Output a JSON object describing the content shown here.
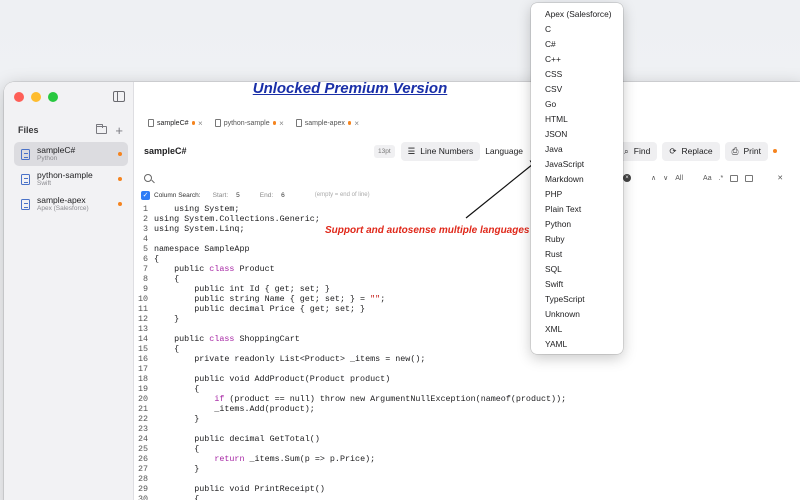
{
  "promo": {
    "text": "Unlocked Premium Version"
  },
  "annotation": {
    "text": "Support and autosense multiple languages"
  },
  "sidebar": {
    "title": "Files",
    "files": [
      {
        "name": "sampleC#",
        "lang": "Python",
        "selected": true,
        "dirty": true
      },
      {
        "name": "python-sample",
        "lang": "Swift",
        "selected": false,
        "dirty": true
      },
      {
        "name": "sample-apex",
        "lang": "Apex (Salesforce)",
        "selected": false,
        "dirty": true
      }
    ]
  },
  "tabs": [
    {
      "label": "sampleC#",
      "close": "×"
    },
    {
      "label": "python-sample",
      "close": "×"
    },
    {
      "label": "sample-apex",
      "close": "×"
    }
  ],
  "toolbar": {
    "title": "sampleC#",
    "font_size": "13pt",
    "line_numbers": "Line Numbers",
    "language": "Language",
    "find": "Find",
    "replace": "Replace",
    "print": "Print"
  },
  "search": {
    "value": "",
    "all": "All",
    "case": "Aa",
    "regex": ".*"
  },
  "column_search": {
    "label": "Column Search:",
    "start_label": "Start:",
    "start": "5",
    "end_label": "End:",
    "end": "6",
    "hint": "(empty = end of line)"
  },
  "language_menu": {
    "items": [
      "Apex (Salesforce)",
      "C",
      "C#",
      "C++",
      "CSS",
      "CSV",
      "Go",
      "HTML",
      "JSON",
      "Java",
      "JavaScript",
      "Markdown",
      "PHP",
      "Plain Text",
      "Python",
      "Ruby",
      "Rust",
      "SQL",
      "Swift",
      "TypeScript",
      "Unknown",
      "XML",
      "YAML"
    ]
  },
  "code_lines": [
    [
      [
        "    using System;",
        ""
      ]
    ],
    [
      [
        "using System.Collections.Generic;",
        ""
      ]
    ],
    [
      [
        "using System.Linq;",
        ""
      ]
    ],
    [
      [
        "",
        ""
      ]
    ],
    [
      [
        "namespace SampleApp",
        ""
      ]
    ],
    [
      [
        "{",
        ""
      ]
    ],
    [
      [
        "    public ",
        ""
      ],
      [
        "class",
        "kw"
      ],
      [
        " Product",
        ""
      ]
    ],
    [
      [
        "    {",
        ""
      ]
    ],
    [
      [
        "        public int Id { get; set; }",
        ""
      ]
    ],
    [
      [
        "        public string Name { get; set; } = ",
        ""
      ],
      [
        "\"\"",
        "str"
      ],
      [
        ";",
        ""
      ]
    ],
    [
      [
        "        public decimal Price { get; set; }",
        ""
      ]
    ],
    [
      [
        "    }",
        ""
      ]
    ],
    [
      [
        "",
        ""
      ]
    ],
    [
      [
        "    public ",
        ""
      ],
      [
        "class",
        "kw"
      ],
      [
        " ShoppingCart",
        ""
      ]
    ],
    [
      [
        "    {",
        ""
      ]
    ],
    [
      [
        "        private readonly List<Product> _items = new();",
        ""
      ]
    ],
    [
      [
        "",
        ""
      ]
    ],
    [
      [
        "        public void AddProduct(Product product)",
        ""
      ]
    ],
    [
      [
        "        {",
        ""
      ]
    ],
    [
      [
        "            ",
        ""
      ],
      [
        "if",
        "kw"
      ],
      [
        " (product == null) throw new ArgumentNullException(nameof(product));",
        ""
      ]
    ],
    [
      [
        "            _items.Add(product);",
        ""
      ]
    ],
    [
      [
        "        }",
        ""
      ]
    ],
    [
      [
        "",
        ""
      ]
    ],
    [
      [
        "        public decimal GetTotal()",
        ""
      ]
    ],
    [
      [
        "        {",
        ""
      ]
    ],
    [
      [
        "            ",
        ""
      ],
      [
        "return",
        "kw"
      ],
      [
        " _items.Sum(p => p.Price);",
        ""
      ]
    ],
    [
      [
        "        }",
        ""
      ]
    ],
    [
      [
        "",
        ""
      ]
    ],
    [
      [
        "        public void PrintReceipt()",
        ""
      ]
    ],
    [
      [
        "        {",
        ""
      ]
    ]
  ]
}
